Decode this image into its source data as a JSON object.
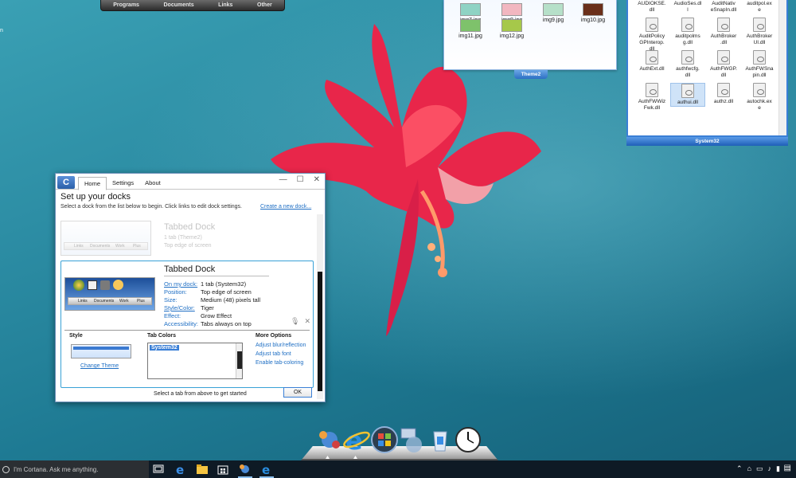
{
  "top_dock": {
    "tabs": [
      "Programs",
      "Documents",
      "Links",
      "Other"
    ]
  },
  "theme2_dock": {
    "label": "Theme2",
    "items": [
      {
        "name": "img7.jpg",
        "color": "#8fd3c4"
      },
      {
        "name": "img8.jpg",
        "color": "#f2b7c0"
      },
      {
        "name": "img9.jpg",
        "color": "#b6e0c9"
      },
      {
        "name": "img10.jpg",
        "color": "#6a2f1a"
      },
      {
        "name": "img11.jpg",
        "color": "#7ec26b"
      },
      {
        "name": "img12.jpg",
        "color": "#a6c84a"
      }
    ]
  },
  "system32_dock": {
    "label": "System32",
    "items": [
      "AUDIOKSE.\ndll",
      "AudioSes.dl\nl",
      "AuditNativ\neSnapIn.dll",
      "auditpol.ex\ne",
      "AuditPolicy\nGPInterop.\ndll",
      "auditpolms\ng.dll",
      "AuthBroker\n.dll",
      "AuthBroker\nUI.dll",
      "AuthExt.dll",
      "authfwcfg.\ndll",
      "AuthFWGP.\ndll",
      "AuthFWSna\npin.dll",
      "AuthFWWiz\nFwk.dll",
      "authui.dll",
      "authz.dll",
      "autochk.ex\ne"
    ]
  },
  "settings_window": {
    "logo": "C",
    "tabs": [
      "Home",
      "Settings",
      "About"
    ],
    "controls": {
      "minimize": "—",
      "maximize": "☐",
      "close": "✕"
    },
    "heading": "Set up your docks",
    "subtext": "Select a dock from the list below to begin. Click links to edit dock settings.",
    "create_link": "Create a new dock...",
    "ghost_dock": {
      "title": "Tabbed Dock",
      "line1": "1 tab (Theme2)",
      "line2": "Top edge of screen",
      "preview_labels": [
        "Links",
        "Documents",
        "Work",
        "Plus"
      ]
    },
    "active_dock": {
      "title": "Tabbed Dock",
      "preview_labels": [
        "Links",
        "Documents",
        "Work",
        "Plus"
      ],
      "details": [
        {
          "label": "On my dock:",
          "value": "1 tab (System32)",
          "link": true
        },
        {
          "label": "Position:",
          "value": "Top edge of screen",
          "link": false
        },
        {
          "label": "Size:",
          "value": "Medium (48) pixels tall",
          "link": false
        },
        {
          "label": "Style/Color:",
          "value": "Tiger",
          "link": true
        },
        {
          "label": "Effect:",
          "value": "Grow Effect",
          "link": false
        },
        {
          "label": "Accessibility:",
          "value": "Tabs always on top",
          "link": false
        }
      ]
    },
    "style_heading": "Style",
    "change_theme": "Change Theme",
    "tab_colors_heading": "Tab Colors",
    "tab_colors_selected": "System32",
    "more_options_heading": "More Options",
    "more_options": [
      "Adjust blur/reflection",
      "Adjust tab font",
      "Enable tab-coloring"
    ],
    "footer_text": "Select a tab from above to get started",
    "ok_label": "OK"
  },
  "taskbar": {
    "search_placeholder": "I'm Cortana. Ask me anything."
  }
}
